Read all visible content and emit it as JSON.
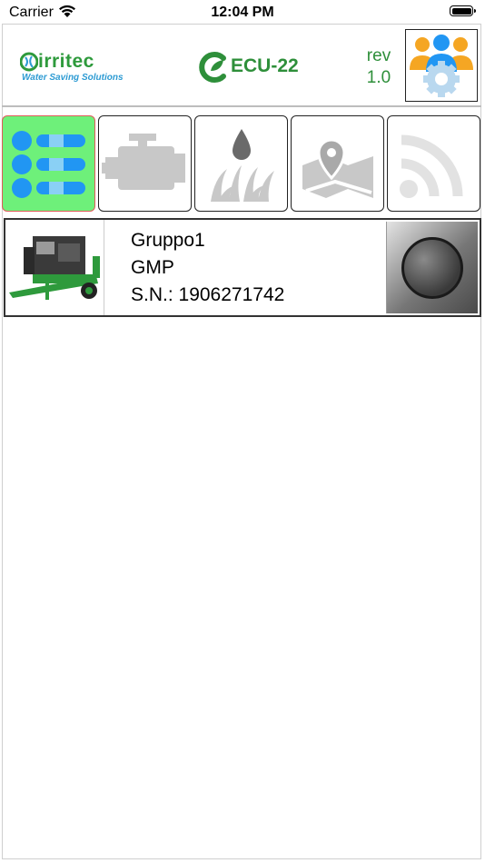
{
  "status_bar": {
    "carrier": "Carrier",
    "time": "12:04 PM"
  },
  "header": {
    "brand_name": "irritec",
    "brand_tagline": "Water Saving Solutions",
    "product_name": "ECU-22",
    "rev_label": "rev",
    "rev_value": "1.0"
  },
  "tabs": [
    {
      "icon": "list-icon",
      "active": true
    },
    {
      "icon": "engine-icon",
      "active": false
    },
    {
      "icon": "irrigation-drop-icon",
      "active": false
    },
    {
      "icon": "map-location-icon",
      "active": false
    },
    {
      "icon": "signal-icon",
      "active": false
    }
  ],
  "devices": [
    {
      "name": "Gruppo1",
      "model": "GMP",
      "serial": "S.N.: 1906271742"
    }
  ],
  "colors": {
    "accent_green": "#2e8f3a",
    "active_tab": "#6ef07a",
    "active_tab_border": "#e05a5a",
    "icon_blue": "#2196f3",
    "icon_gray": "#c8c8c8"
  }
}
